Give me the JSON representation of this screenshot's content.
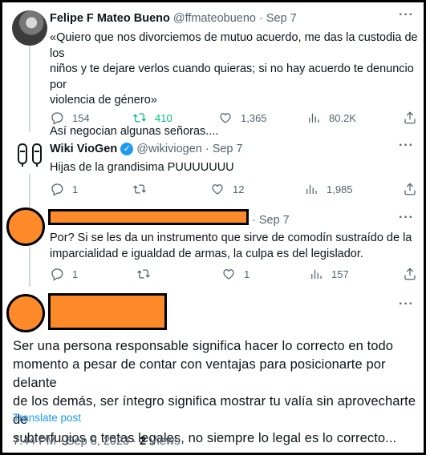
{
  "tweet1": {
    "name": "Felipe F Mateo Bueno",
    "handle": "@ffmateobueno",
    "separator": "·",
    "date": "Sep 7",
    "text_lines": [
      "«Quiero que nos divorciemos de mutuo acuerdo, me das la custodia de los",
      "niños y te dejare verlos cuando quieras; si no hay acuerdo te denuncio por",
      "violencia de género»",
      "",
      "Así negocian algunas señoras...."
    ],
    "replies": "154",
    "retweets": "410",
    "likes": "1,365",
    "views": "80.2K"
  },
  "tweet2": {
    "name": "Wiki VioGen",
    "handle": "@wikiviogen",
    "separator": "·",
    "date": "Sep 7",
    "text": "Hijas de la grandisima PUUUUUUU",
    "replies": "1",
    "retweets": "",
    "likes": "12",
    "views": "1,985"
  },
  "tweet3": {
    "separator": "·",
    "date": "Sep 7",
    "text_lines": [
      "Por? Si se les da un instrumento que sirve de comodín sustraído de la",
      "imparcialidad e igualdad de armas, la culpa es del legislador."
    ],
    "replies": "1",
    "retweets": "",
    "likes": "1",
    "views": "157"
  },
  "main": {
    "text_lines": [
      "Ser una persona responsable significa hacer lo correcto en todo",
      "momento a pesar de contar con ventajas para posicionarte por delante",
      "de los demás, ser íntegro significa mostrar tu valía sin aprovecharte de",
      "subterfugios o tretas legales, no siempre lo legal es lo correcto..."
    ],
    "translate": "Translate post",
    "timestamp": "7:44 PM · Sep 8, 2023 · ",
    "view_count": "2",
    "views_label": " Views"
  },
  "colors": {
    "accent": "#1d9bf0",
    "retweet_green": "#00ba7c",
    "redaction": "#ff8a2a",
    "muted": "#536471"
  },
  "icons": [
    "reply-icon",
    "retweet-icon",
    "like-icon",
    "views-icon",
    "share-icon",
    "more-icon",
    "verified-icon"
  ]
}
